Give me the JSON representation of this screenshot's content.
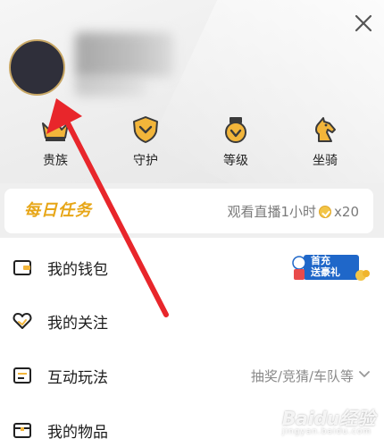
{
  "header": {
    "close_icon": "close-icon",
    "privileges": [
      {
        "label": "贵族",
        "icon": "crown-icon"
      },
      {
        "label": "守护",
        "icon": "shield-icon"
      },
      {
        "label": "等级",
        "icon": "medal-icon"
      },
      {
        "label": "坐骑",
        "icon": "horse-icon"
      }
    ]
  },
  "daily_task": {
    "badge": "每日任务",
    "task_text": "观看直播1小时",
    "reward": "x20"
  },
  "menu": {
    "items": [
      {
        "label": "我的钱包",
        "icon": "wallet-icon",
        "promo": [
          "首充",
          "送豪礼"
        ]
      },
      {
        "label": "我的关注",
        "icon": "heart-icon"
      },
      {
        "label": "互动玩法",
        "icon": "game-icon",
        "value": "抽奖/竞猜/车队等"
      },
      {
        "label": "我的物品",
        "icon": "box-icon"
      }
    ]
  },
  "watermark": {
    "text": "Baidu经验",
    "sub": "jingyan.baidu.com"
  },
  "colors": {
    "accent": "#e7a617",
    "arrow": "#e8262b",
    "avatar_ring": "#c8a765"
  }
}
